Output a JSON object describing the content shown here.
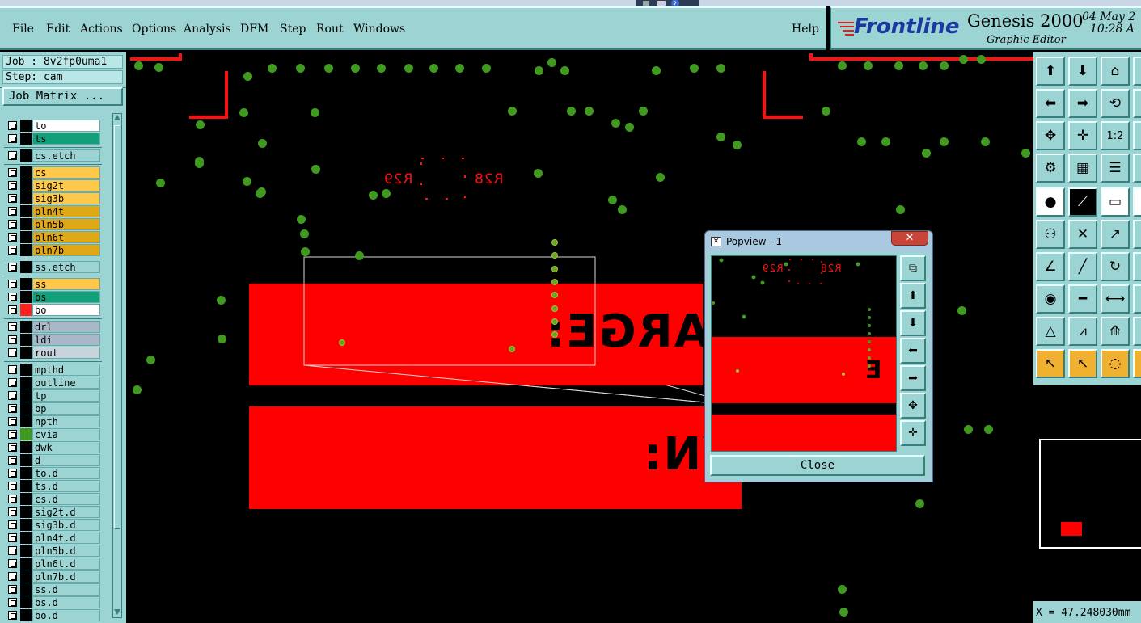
{
  "menu": {
    "items": [
      "File",
      "Edit",
      "Actions",
      "Options",
      "Analysis",
      "DFM",
      "Step",
      "Rout",
      "Windows"
    ],
    "help": "Help"
  },
  "brand": {
    "logo": "Frontline",
    "product": "Genesis 2000",
    "subtitle": "Graphic Editor",
    "date": "04 May 2",
    "time": "10:28 A"
  },
  "job": {
    "job_label": "Job : 8v2fp0uma1",
    "step_label": "Step: cam",
    "matrix_button": "Job Matrix ..."
  },
  "layers": [
    {
      "name": "to",
      "color": "#ffffff",
      "swatch": "#000000"
    },
    {
      "name": "ts",
      "color": "#12a07a",
      "swatch": "#000000"
    },
    {
      "name": "cs.etch",
      "color": "#9cd4d4",
      "swatch": "#000000"
    },
    {
      "name": "cs",
      "color": "#ffc84a",
      "swatch": "#000000"
    },
    {
      "name": "sig2t",
      "color": "#ffc84a",
      "swatch": "#000000"
    },
    {
      "name": "sig3b",
      "color": "#ffc84a",
      "swatch": "#000000"
    },
    {
      "name": "pln4t",
      "color": "#e0a818",
      "swatch": "#000000"
    },
    {
      "name": "pln5b",
      "color": "#e0a818",
      "swatch": "#000000"
    },
    {
      "name": "pln6t",
      "color": "#e0a818",
      "swatch": "#000000"
    },
    {
      "name": "pln7b",
      "color": "#e0a818",
      "swatch": "#000000"
    },
    {
      "name": "ss.etch",
      "color": "#9cd4d4",
      "swatch": "#000000"
    },
    {
      "name": "ss",
      "color": "#ffc84a",
      "swatch": "#000000"
    },
    {
      "name": "bs",
      "color": "#12a07a",
      "swatch": "#000000"
    },
    {
      "name": "bo",
      "color": "#ffffff",
      "swatch": "#ff2020"
    },
    {
      "name": "drl",
      "color": "#a8b8c8",
      "swatch": "#000000"
    },
    {
      "name": "ldi",
      "color": "#a8b8c8",
      "swatch": "#000000"
    },
    {
      "name": "rout",
      "color": "#c8d4dc",
      "swatch": "#000000"
    },
    {
      "name": "mpthd",
      "color": "#9cd4d4",
      "swatch": "#000000"
    },
    {
      "name": "outline",
      "color": "#9cd4d4",
      "swatch": "#000000"
    },
    {
      "name": "tp",
      "color": "#9cd4d4",
      "swatch": "#000000"
    },
    {
      "name": "bp",
      "color": "#9cd4d4",
      "swatch": "#000000"
    },
    {
      "name": "npth",
      "color": "#9cd4d4",
      "swatch": "#000000"
    },
    {
      "name": "cvia",
      "color": "#9cd4d4",
      "swatch": "#3f9a1f"
    },
    {
      "name": "dwk",
      "color": "#9cd4d4",
      "swatch": "#000000"
    },
    {
      "name": "d",
      "color": "#9cd4d4",
      "swatch": "#000000"
    },
    {
      "name": "to.d",
      "color": "#9cd4d4",
      "swatch": "#000000"
    },
    {
      "name": "ts.d",
      "color": "#9cd4d4",
      "swatch": "#000000"
    },
    {
      "name": "cs.d",
      "color": "#9cd4d4",
      "swatch": "#000000"
    },
    {
      "name": "sig2t.d",
      "color": "#9cd4d4",
      "swatch": "#000000"
    },
    {
      "name": "sig3b.d",
      "color": "#9cd4d4",
      "swatch": "#000000"
    },
    {
      "name": "pln4t.d",
      "color": "#9cd4d4",
      "swatch": "#000000"
    },
    {
      "name": "pln5b.d",
      "color": "#9cd4d4",
      "swatch": "#000000"
    },
    {
      "name": "pln6t.d",
      "color": "#9cd4d4",
      "swatch": "#000000"
    },
    {
      "name": "pln7b.d",
      "color": "#9cd4d4",
      "swatch": "#000000"
    },
    {
      "name": "ss.d",
      "color": "#9cd4d4",
      "swatch": "#000000"
    },
    {
      "name": "bs.d",
      "color": "#9cd4d4",
      "swatch": "#000000"
    },
    {
      "name": "bo.d",
      "color": "#9cd4d4",
      "swatch": "#000000"
    }
  ],
  "canvas": {
    "refdes_left": "R29",
    "refdes_right": "R28",
    "text_upper": "HARGE:",
    "text_lower": "/N:"
  },
  "popview": {
    "title": "Popview - 1",
    "close_label": "Close",
    "refdes_left": "R29",
    "refdes_right": "R28",
    "fragment": "E"
  },
  "status": {
    "coords": "X = 47.248030mm"
  },
  "colors": {
    "copper_red": "#ff0000",
    "pad_green": "#3f9a1f",
    "panel_teal": "#9cd4d4",
    "brand_red": "#e0201a",
    "brand_blue": "#1a3aa0"
  },
  "icons": {
    "toolbar": [
      "pan-up-icon",
      "pan-down-icon",
      "home-icon",
      "zoom-icon",
      "pan-left-icon",
      "pan-right-icon",
      "fit-icon",
      "misc-icon",
      "zoom-fit-icon",
      "zoom-center-icon",
      "ratio-1-2-icon",
      "misc2-icon",
      "snap-icon",
      "grid-icon",
      "layers-icon",
      "misc3-icon",
      "pad-icon",
      "line-select-icon",
      "ruler-icon",
      "misc4-icon",
      "net-icon",
      "cross-icon",
      "connect-icon",
      "misc5-icon",
      "angle-icon",
      "line-draw-icon",
      "arc-icon",
      "misc6-icon",
      "node-icon",
      "segment-icon",
      "measure-icon",
      "misc7-icon",
      "triangle-icon",
      "triangle-up-icon",
      "triangle-arrow-icon",
      "misc8-icon",
      "pointer-icon",
      "pointer-box-icon",
      "pointer-circle-icon",
      "misc9-icon"
    ]
  }
}
